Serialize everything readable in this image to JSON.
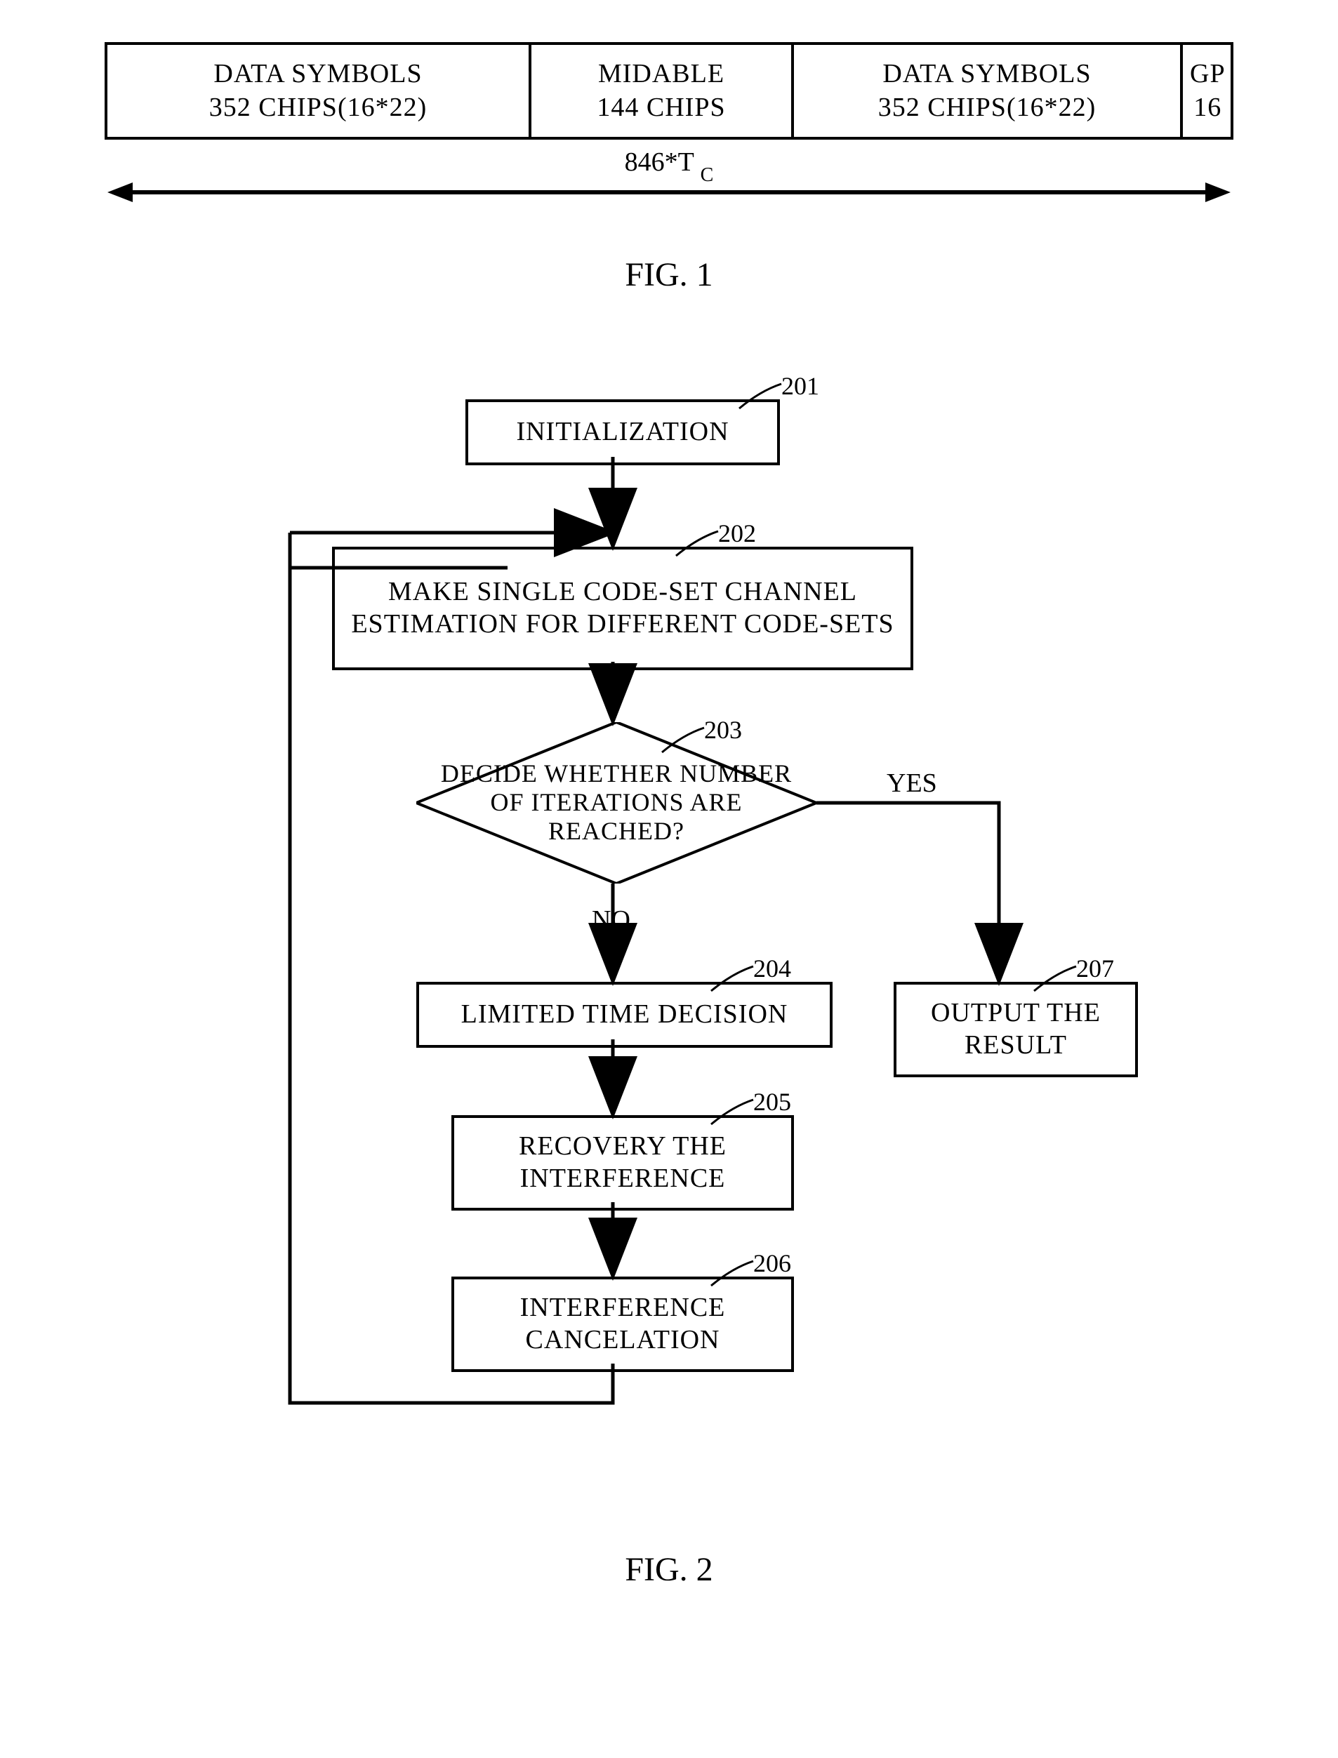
{
  "fig1": {
    "caption": "FIG. 1",
    "cells": {
      "c1_line1": "DATA  SYMBOLS",
      "c1_line2": "352 CHIPS(16*22)",
      "c2_line1": "MIDABLE",
      "c2_line2": "144 CHIPS",
      "c3_line1": "DATA SYMBOLS",
      "c3_line2": "352 CHIPS(16*22)",
      "c4_line1": "GP",
      "c4_line2": "16"
    },
    "dim_label_main": "846*T",
    "dim_label_sub": "C"
  },
  "fig2": {
    "caption": "FIG. 2",
    "refs": {
      "r201": "201",
      "r202": "202",
      "r203": "203",
      "r204": "204",
      "r205": "205",
      "r206": "206",
      "r207": "207"
    },
    "boxes": {
      "b201": "INITIALIZATION",
      "b202": "MAKE SINGLE CODE-SET CHANNEL ESTIMATION FOR DIFFERENT CODE-SETS",
      "b203": "DECIDE WHETHER NUMBER OF ITERATIONS ARE REACHED?",
      "b204": "LIMITED TIME DECISION",
      "b205": "RECOVERY THE INTERFERENCE",
      "b206": "INTERFERENCE CANCELATION",
      "b207": "OUTPUT THE RESULT"
    },
    "edges": {
      "yes": "YES",
      "no": "NO"
    }
  }
}
